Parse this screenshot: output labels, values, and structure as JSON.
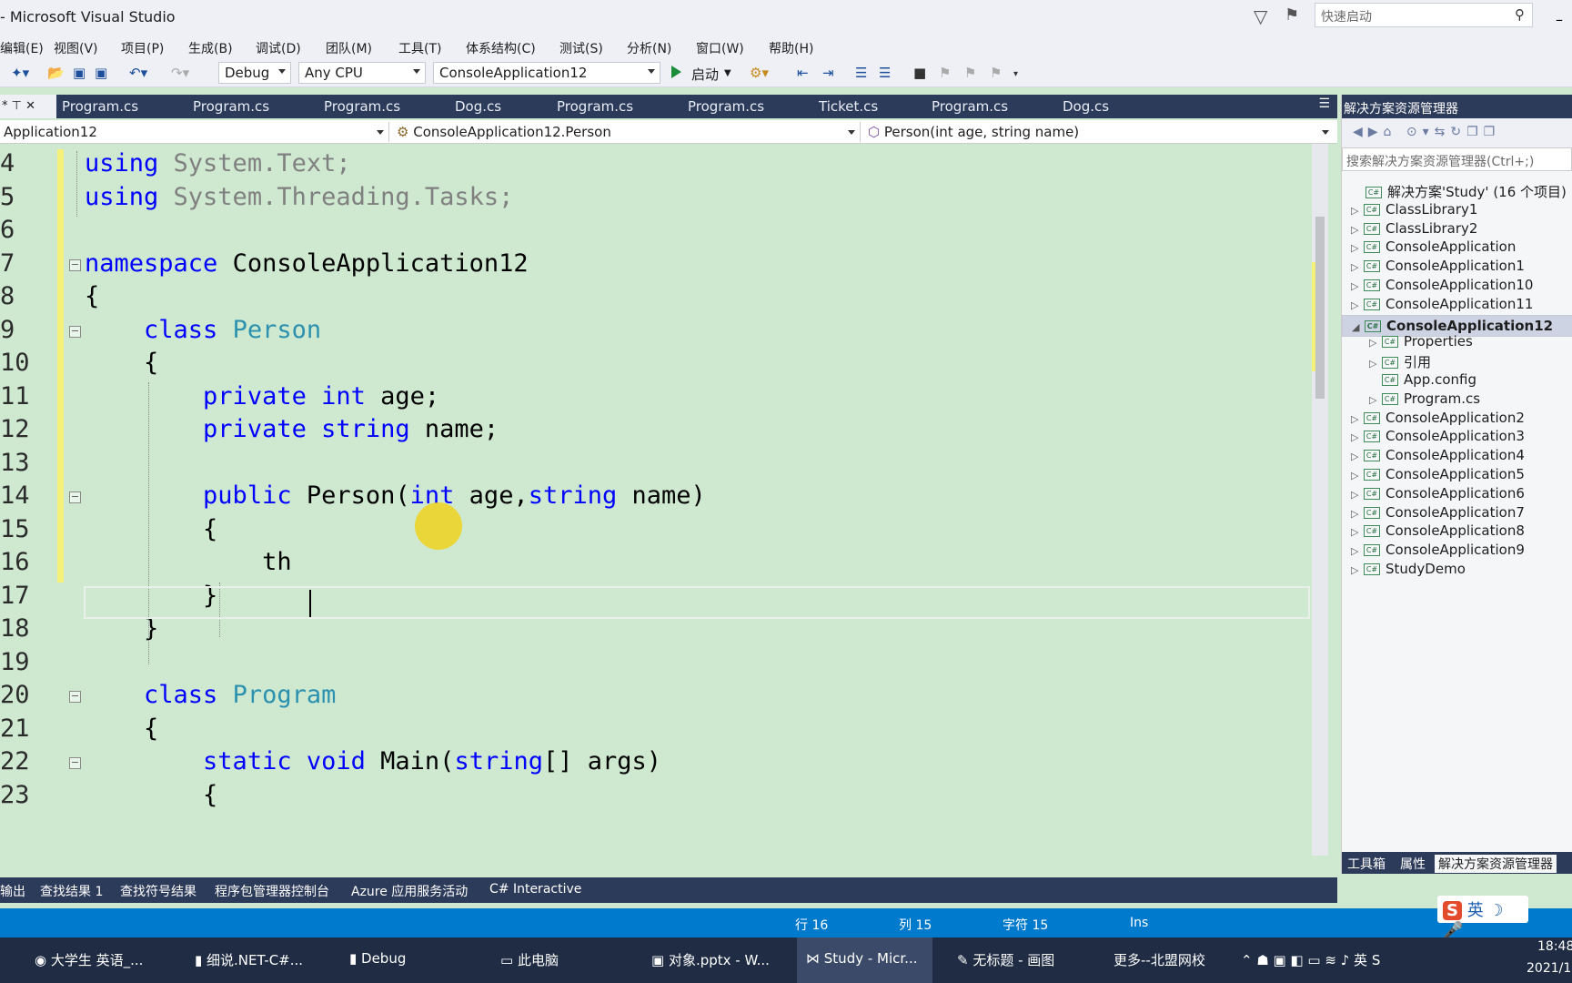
{
  "window": {
    "title": "- Microsoft Visual Studio",
    "quick_launch": "快速启动"
  },
  "menu": [
    "编辑(E)",
    "视图(V)",
    "项目(P)",
    "生成(B)",
    "调试(D)",
    "团队(M)",
    "工具(T)",
    "体系结构(C)",
    "测试(S)",
    "分析(N)",
    "窗口(W)",
    "帮助(H)"
  ],
  "toolbar": {
    "config": "Debug",
    "platform": "Any CPU",
    "project": "ConsoleApplication12",
    "start": "启动"
  },
  "tabs": [
    "Program.cs",
    "Program.cs",
    "Program.cs",
    "Dog.cs",
    "Program.cs",
    "Program.cs",
    "Ticket.cs",
    "Program.cs",
    "Dog.cs"
  ],
  "navbar": {
    "project": "Application12",
    "class": "ConsoleApplication12.Person",
    "member": "Person(int age, string name)"
  },
  "code_lines": [
    {
      "n": "4",
      "tokens": [
        [
          "k",
          "using"
        ],
        [
          "g",
          " System.Text;"
        ]
      ]
    },
    {
      "n": "5",
      "tokens": [
        [
          "k",
          "using"
        ],
        [
          "g",
          " System.Threading.Tasks;"
        ]
      ]
    },
    {
      "n": "6",
      "tokens": []
    },
    {
      "n": "7",
      "tokens": [
        [
          "k",
          "namespace"
        ],
        [
          "t",
          " ConsoleApplication12"
        ]
      ]
    },
    {
      "n": "8",
      "tokens": [
        [
          "t",
          "{"
        ]
      ]
    },
    {
      "n": "9",
      "tokens": [
        [
          "t",
          "    "
        ],
        [
          "k",
          "class"
        ],
        [
          "t",
          " "
        ],
        [
          "c",
          "Person"
        ]
      ]
    },
    {
      "n": "10",
      "tokens": [
        [
          "t",
          "    {"
        ]
      ]
    },
    {
      "n": "11",
      "tokens": [
        [
          "t",
          "        "
        ],
        [
          "k",
          "private"
        ],
        [
          "t",
          " "
        ],
        [
          "k",
          "int"
        ],
        [
          "t",
          " age;"
        ]
      ]
    },
    {
      "n": "12",
      "tokens": [
        [
          "t",
          "        "
        ],
        [
          "k",
          "private"
        ],
        [
          "t",
          " "
        ],
        [
          "k",
          "string"
        ],
        [
          "t",
          " name;"
        ]
      ]
    },
    {
      "n": "13",
      "tokens": []
    },
    {
      "n": "14",
      "tokens": [
        [
          "t",
          "        "
        ],
        [
          "k",
          "public"
        ],
        [
          "t",
          " Person("
        ],
        [
          "k",
          "int"
        ],
        [
          "t",
          " age,"
        ],
        [
          "k",
          "string"
        ],
        [
          "t",
          " name)"
        ]
      ]
    },
    {
      "n": "15",
      "tokens": [
        [
          "t",
          "        {"
        ]
      ]
    },
    {
      "n": "16",
      "tokens": [
        [
          "t",
          "            th"
        ]
      ]
    },
    {
      "n": "17",
      "tokens": [
        [
          "t",
          "        }"
        ]
      ]
    },
    {
      "n": "18",
      "tokens": [
        [
          "t",
          "    }"
        ]
      ]
    },
    {
      "n": "19",
      "tokens": []
    },
    {
      "n": "20",
      "tokens": [
        [
          "t",
          "    "
        ],
        [
          "k",
          "class"
        ],
        [
          "t",
          " "
        ],
        [
          "c",
          "Program"
        ]
      ]
    },
    {
      "n": "21",
      "tokens": [
        [
          "t",
          "    {"
        ]
      ]
    },
    {
      "n": "22",
      "tokens": [
        [
          "t",
          "        "
        ],
        [
          "k",
          "static"
        ],
        [
          "t",
          " "
        ],
        [
          "k",
          "void"
        ],
        [
          "t",
          " Main("
        ],
        [
          "k",
          "string"
        ],
        [
          "t",
          "[] args)"
        ]
      ]
    },
    {
      "n": "23",
      "tokens": [
        [
          "t",
          "        {"
        ]
      ]
    }
  ],
  "solution_explorer": {
    "title": "解决方案资源管理器",
    "search": "搜索解决方案资源管理器(Ctrl+;)",
    "items": [
      {
        "label": "解决方案'Study' (16 个项目)",
        "level": 0,
        "arrow": ""
      },
      {
        "label": "ClassLibrary1",
        "level": 1,
        "arrow": "▷"
      },
      {
        "label": "ClassLibrary2",
        "level": 1,
        "arrow": "▷"
      },
      {
        "label": "ConsoleApplication",
        "level": 1,
        "arrow": "▷"
      },
      {
        "label": "ConsoleApplication1",
        "level": 1,
        "arrow": "▷"
      },
      {
        "label": "ConsoleApplication10",
        "level": 1,
        "arrow": "▷"
      },
      {
        "label": "ConsoleApplication11",
        "level": 1,
        "arrow": "▷"
      },
      {
        "label": "ConsoleApplication12",
        "level": 1,
        "arrow": "◢",
        "selected": true
      },
      {
        "label": "Properties",
        "level": 2,
        "arrow": "▷"
      },
      {
        "label": "引用",
        "level": 2,
        "arrow": "▷"
      },
      {
        "label": "App.config",
        "level": 2,
        "arrow": ""
      },
      {
        "label": "Program.cs",
        "level": 2,
        "arrow": "▷"
      },
      {
        "label": "ConsoleApplication2",
        "level": 1,
        "arrow": "▷"
      },
      {
        "label": "ConsoleApplication3",
        "level": 1,
        "arrow": "▷"
      },
      {
        "label": "ConsoleApplication4",
        "level": 1,
        "arrow": "▷"
      },
      {
        "label": "ConsoleApplication5",
        "level": 1,
        "arrow": "▷"
      },
      {
        "label": "ConsoleApplication6",
        "level": 1,
        "arrow": "▷"
      },
      {
        "label": "ConsoleApplication7",
        "level": 1,
        "arrow": "▷"
      },
      {
        "label": "ConsoleApplication8",
        "level": 1,
        "arrow": "▷"
      },
      {
        "label": "ConsoleApplication9",
        "level": 1,
        "arrow": "▷"
      },
      {
        "label": "StudyDemo",
        "level": 1,
        "arrow": "▷"
      }
    ],
    "bottom_tabs": [
      "工具箱",
      "属性",
      "解决方案资源管理器"
    ]
  },
  "output_tabs": [
    "输出",
    "查找结果 1",
    "查找符号结果",
    "程序包管理器控制台",
    "Azure 应用服务活动",
    "C# Interactive"
  ],
  "status": {
    "line": "行 16",
    "col": "列 15",
    "char": "字符 15",
    "mode": "Ins"
  },
  "taskbar": [
    "大学生 英语_...",
    "细说.NET-C#...",
    "Debug",
    "此电脑",
    "对象.pptx - W...",
    "Study - Micr...",
    "无标题 - 画图",
    "更多--北盟网校"
  ],
  "clock": {
    "time": "18:48",
    "date": "2021/1"
  },
  "ime": {
    "label": "英"
  }
}
